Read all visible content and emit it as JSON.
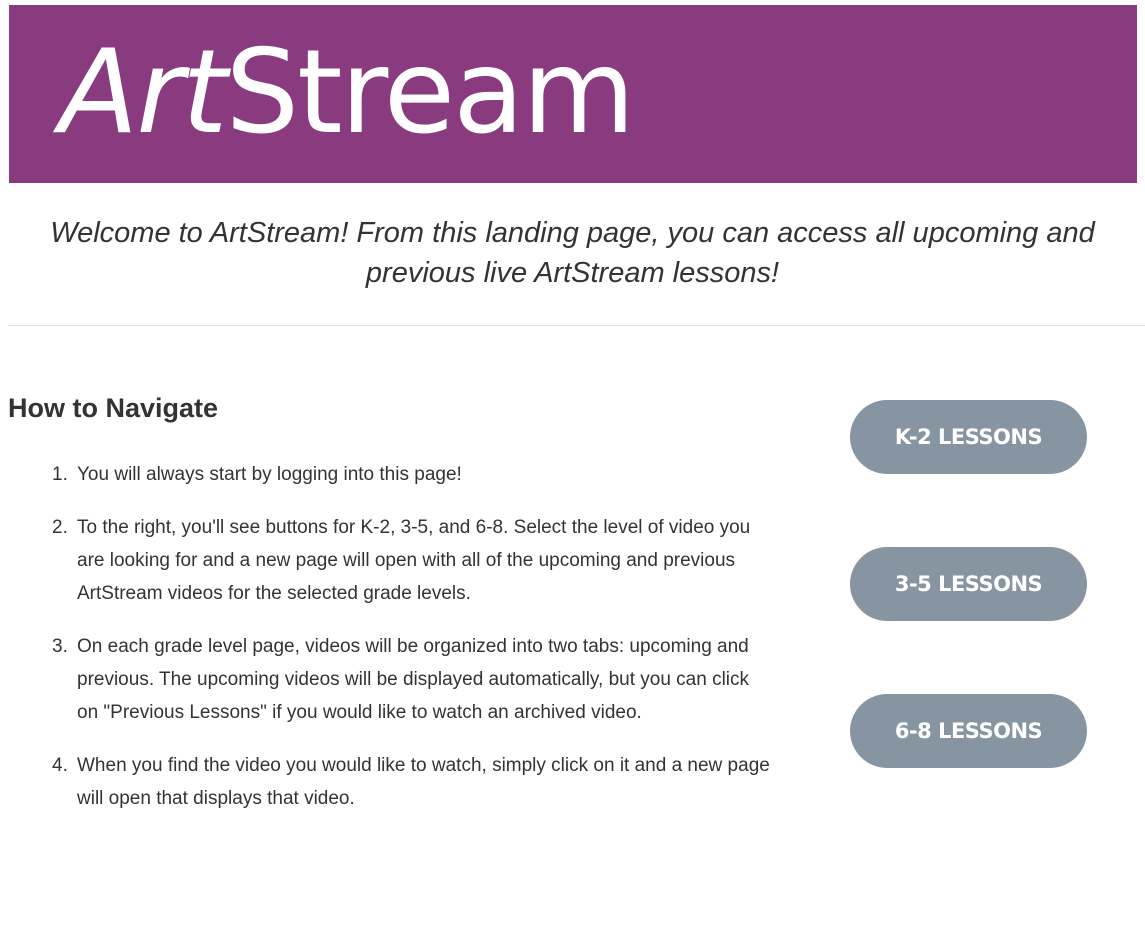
{
  "banner": {
    "logo_part1": "Art",
    "logo_part2": "Stream",
    "background_color": "#8a3a7e"
  },
  "welcome": {
    "line1": "Welcome to ArtStream! From this landing page, you can access all upcoming and",
    "line2": "previous live ArtStream lessons!"
  },
  "navigation": {
    "heading": "How to Navigate",
    "steps": [
      {
        "num": "1.",
        "text": "You will always start by logging into this page!"
      },
      {
        "num": "2.",
        "text": "To the right, you'll see buttons for K-2, 3-5, and 6-8. Select the level of video you are looking for and a new page will open with all of the upcoming and previous ArtStream videos for the selected grade levels."
      },
      {
        "num": "3.",
        "text": "On each grade level page, videos will be organized into two tabs: upcoming and previous. The upcoming videos will be displayed automatically, but you can click on \"Previous Lessons\" if you would like to watch an archived video."
      },
      {
        "num": "4.",
        "text": "When you find the video you would like to watch, simply click on it and a new page will open that displays that video."
      }
    ]
  },
  "buttons": {
    "k2": "K-2 LESSONS",
    "g35": "3-5 LESSONS",
    "g68": "6-8 LESSONS",
    "color": "#8795a3"
  }
}
